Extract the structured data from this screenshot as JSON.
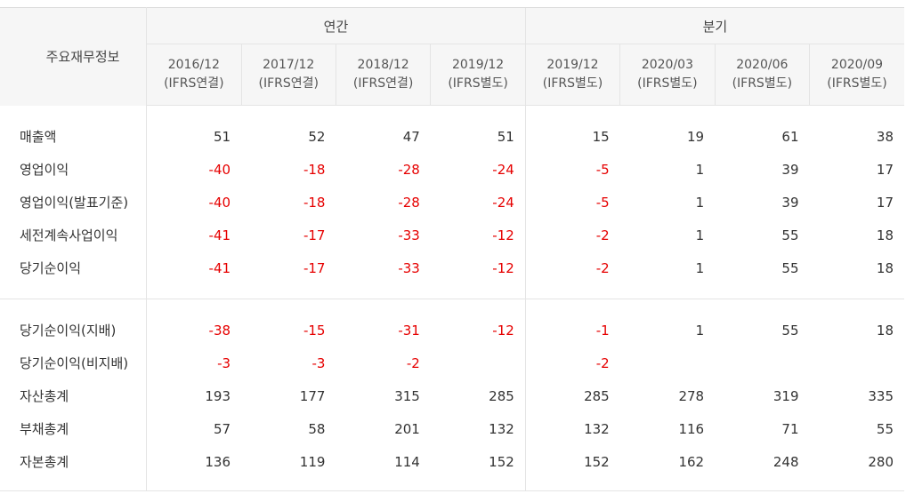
{
  "header": {
    "label": "주요재무정보",
    "group_annual": "연간",
    "group_quarter": "분기",
    "periods": [
      {
        "date": "2016/12",
        "basis": "(IFRS연결)"
      },
      {
        "date": "2017/12",
        "basis": "(IFRS연결)"
      },
      {
        "date": "2018/12",
        "basis": "(IFRS연결)"
      },
      {
        "date": "2019/12",
        "basis": "(IFRS별도)"
      },
      {
        "date": "2019/12",
        "basis": "(IFRS별도)"
      },
      {
        "date": "2020/03",
        "basis": "(IFRS별도)"
      },
      {
        "date": "2020/06",
        "basis": "(IFRS별도)"
      },
      {
        "date": "2020/09",
        "basis": "(IFRS별도)"
      }
    ]
  },
  "colors": {
    "negative": "#e60000",
    "text": "#333333",
    "border": "#e4e4e4",
    "header_bg": "#f6f6f6"
  },
  "rows_group1": [
    {
      "label": "매출액",
      "values": [
        "51",
        "52",
        "47",
        "51",
        "15",
        "19",
        "61",
        "38"
      ]
    },
    {
      "label": "영업이익",
      "values": [
        "-40",
        "-18",
        "-28",
        "-24",
        "-5",
        "1",
        "39",
        "17"
      ]
    },
    {
      "label": "영업이익(발표기준)",
      "values": [
        "-40",
        "-18",
        "-28",
        "-24",
        "-5",
        "1",
        "39",
        "17"
      ]
    },
    {
      "label": "세전계속사업이익",
      "values": [
        "-41",
        "-17",
        "-33",
        "-12",
        "-2",
        "1",
        "55",
        "18"
      ]
    },
    {
      "label": "당기순이익",
      "values": [
        "-41",
        "-17",
        "-33",
        "-12",
        "-2",
        "1",
        "55",
        "18"
      ]
    }
  ],
  "rows_group2": [
    {
      "label": "당기순이익(지배)",
      "values": [
        "-38",
        "-15",
        "-31",
        "-12",
        "-1",
        "1",
        "55",
        "18"
      ]
    },
    {
      "label": "당기순이익(비지배)",
      "values": [
        "-3",
        "-3",
        "-2",
        "",
        "-2",
        "",
        "",
        ""
      ]
    },
    {
      "label": "자산총계",
      "values": [
        "193",
        "177",
        "315",
        "285",
        "285",
        "278",
        "319",
        "335"
      ]
    },
    {
      "label": "부채총계",
      "values": [
        "57",
        "58",
        "201",
        "132",
        "132",
        "116",
        "71",
        "55"
      ]
    },
    {
      "label": "자본총계",
      "values": [
        "136",
        "119",
        "114",
        "152",
        "152",
        "162",
        "248",
        "280"
      ]
    }
  ]
}
